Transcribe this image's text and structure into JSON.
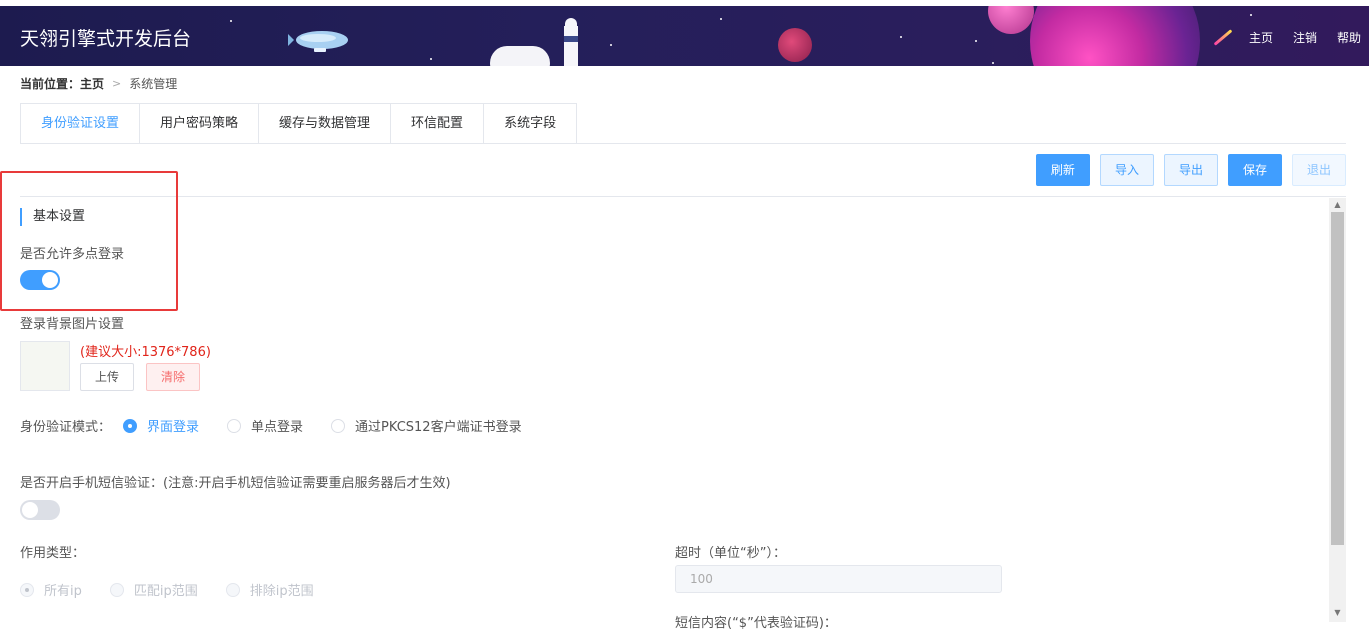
{
  "header": {
    "app_title": "天翎引擎式开发后台",
    "nav": [
      "主页",
      "注销",
      "帮助"
    ]
  },
  "breadcrumb": {
    "prefix": "当前位置：",
    "home": "主页",
    "separator": ">",
    "current": "系统管理"
  },
  "tabs": [
    {
      "label": "身份验证设置",
      "active": true
    },
    {
      "label": "用户密码策略",
      "active": false
    },
    {
      "label": "缓存与数据管理",
      "active": false
    },
    {
      "label": "环信配置",
      "active": false
    },
    {
      "label": "系统字段",
      "active": false
    }
  ],
  "toolbar": {
    "refresh": "刷新",
    "import": "导入",
    "export": "导出",
    "save": "保存",
    "exit": "退出"
  },
  "form": {
    "section_title": "基本设置",
    "multi_login_label": "是否允许多点登录",
    "multi_login_on": true,
    "bg_image_label": "登录背景图片设置",
    "bg_image_hint": "(建议大小:1376*786)",
    "upload_label": "上传",
    "clear_label": "清除",
    "auth_mode_label": "身份验证模式：",
    "auth_modes": [
      {
        "label": "界面登录",
        "checked": true
      },
      {
        "label": "单点登录",
        "checked": false
      },
      {
        "label": "通过PKCS12客户端证书登录",
        "checked": false
      }
    ],
    "sms_label": "是否开启手机短信验证：(注意:开启手机短信验证需要重启服务器后才生效)",
    "sms_on": false,
    "scope_label": "作用类型：",
    "scope_options": [
      {
        "label": "所有ip",
        "checked": true
      },
      {
        "label": "匹配ip范围",
        "checked": false
      },
      {
        "label": "排除ip范围",
        "checked": false
      }
    ],
    "timeout_label": "超时（单位“秒”）：",
    "timeout_value": "100",
    "sms_content_label": "短信内容(“$”代表验证码)："
  },
  "colors": {
    "accent": "#409eff",
    "highlight_box": "#e83a3a",
    "hint_red": "#e1251b"
  }
}
